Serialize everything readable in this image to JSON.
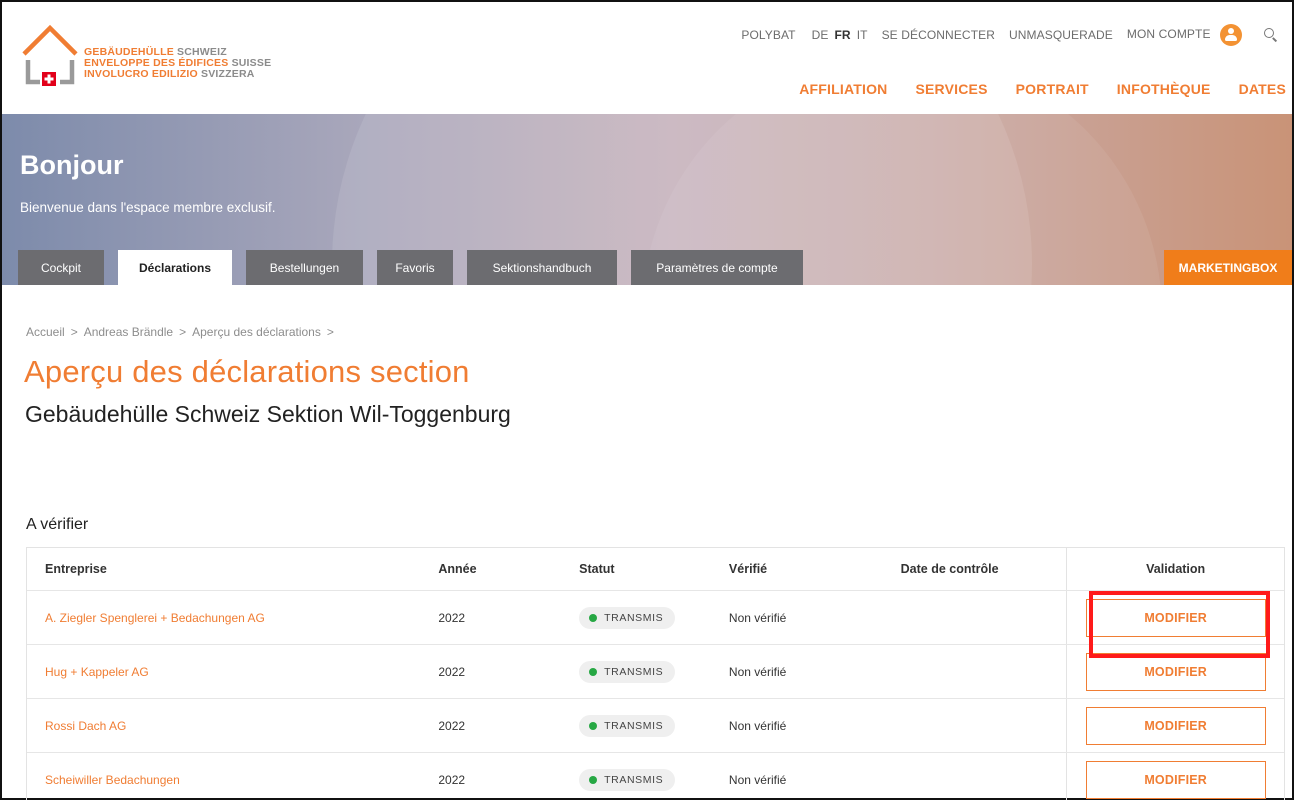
{
  "logo": {
    "line1_a": "GEBÄUDEHÜLLE",
    "line1_b": "SCHWEIZ",
    "line2_a": "ENVELOPPE DES ÉDIFICES",
    "line2_b": "SUISSE",
    "line3_a": "INVOLUCRO EDILIZIO",
    "line3_b": "SVIZZERA"
  },
  "topnav": {
    "polybat": "POLYBAT",
    "lang_de": "DE",
    "lang_fr": "FR",
    "lang_it": "IT",
    "logout": "SE DÉCONNECTER",
    "unmasquerade": "UNMASQUERADE",
    "account": "MON COMPTE"
  },
  "mainnav": [
    "AFFILIATION",
    "SERVICES",
    "PORTRAIT",
    "INFOTHÈQUE",
    "DATES"
  ],
  "hero": {
    "title": "Bonjour",
    "subtitle": "Bienvenue dans l'espace membre exclusif.",
    "marketing": "MARKETINGBOX"
  },
  "tabs": [
    "Cockpit",
    "Déclarations",
    "Bestellungen",
    "Favoris",
    "Sektionshandbuch",
    "Paramètres de compte"
  ],
  "breadcrumb": [
    "Accueil",
    ">",
    "Andreas Brändle",
    ">",
    "Aperçu des déclarations",
    ">"
  ],
  "page": {
    "title": "Aperçu des déclarations section",
    "subtitle": "Gebäudehülle Schweiz Sektion Wil-Toggenburg",
    "section": "A vérifier"
  },
  "table": {
    "headers": [
      "Entreprise",
      "Année",
      "Statut",
      "Vérifié",
      "Date de contrôle",
      "Validation"
    ],
    "rows": [
      {
        "company": "A. Ziegler Spenglerei + Bedachungen AG",
        "year": "2022",
        "status": "TRANSMIS",
        "verified": "Non vérifié",
        "date": "",
        "action": "MODIFIER"
      },
      {
        "company": "Hug + Kappeler AG",
        "year": "2022",
        "status": "TRANSMIS",
        "verified": "Non vérifié",
        "date": "",
        "action": "MODIFIER"
      },
      {
        "company": "Rossi Dach AG",
        "year": "2022",
        "status": "TRANSMIS",
        "verified": "Non vérifié",
        "date": "",
        "action": "MODIFIER"
      },
      {
        "company": "Scheiwiller Bedachungen",
        "year": "2022",
        "status": "TRANSMIS",
        "verified": "Non vérifié",
        "date": "",
        "action": "MODIFIER"
      }
    ]
  },
  "colors": {
    "accent": "#f07d33",
    "status_ok": "#27a844",
    "highlight": "#ff1a1a",
    "tab_bg": "#6c6c70"
  }
}
